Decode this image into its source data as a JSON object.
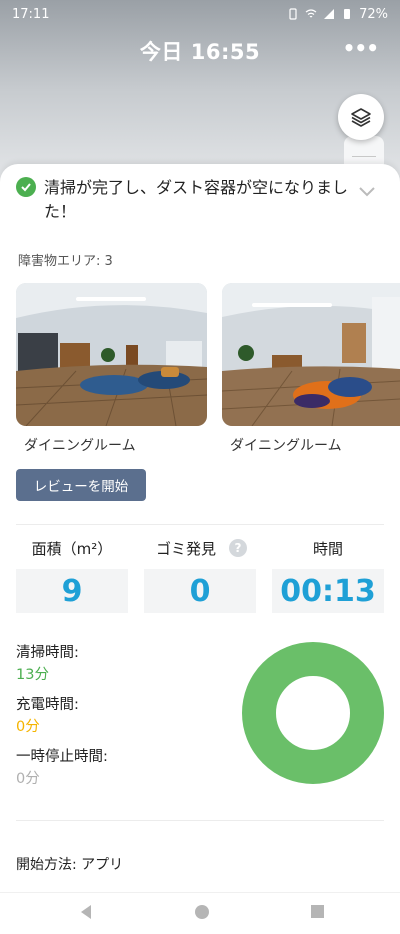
{
  "statusbar": {
    "time": "17:11",
    "battery": "72%"
  },
  "header": {
    "title": "今日 16:55",
    "more": "•••"
  },
  "message": {
    "text": "清掃が完了し、ダスト容器が空になりました！"
  },
  "obstacles": {
    "label": "障害物エリア: 3",
    "items": [
      {
        "caption": "ダイニングルーム"
      },
      {
        "caption": "ダイニングルーム"
      }
    ],
    "review_button": "レビューを開始"
  },
  "stats": {
    "area": {
      "label": "面積（m²）",
      "value": "9"
    },
    "dirt": {
      "label": "ゴミ発見",
      "value": "0",
      "help": "?"
    },
    "time": {
      "label": "時間",
      "value": "00:13"
    }
  },
  "durations": {
    "cleaning": {
      "label": "清掃時間:",
      "value": "13分",
      "color": "#4caf50"
    },
    "charging": {
      "label": "充電時間:",
      "value": "0分",
      "color": "#f5b400"
    },
    "paused": {
      "label": "一時停止時間:",
      "value": "0分",
      "color": "#b0b0b0"
    },
    "donut_color": "#6abf69"
  },
  "start_method": {
    "label": "開始方法: アプリ"
  }
}
